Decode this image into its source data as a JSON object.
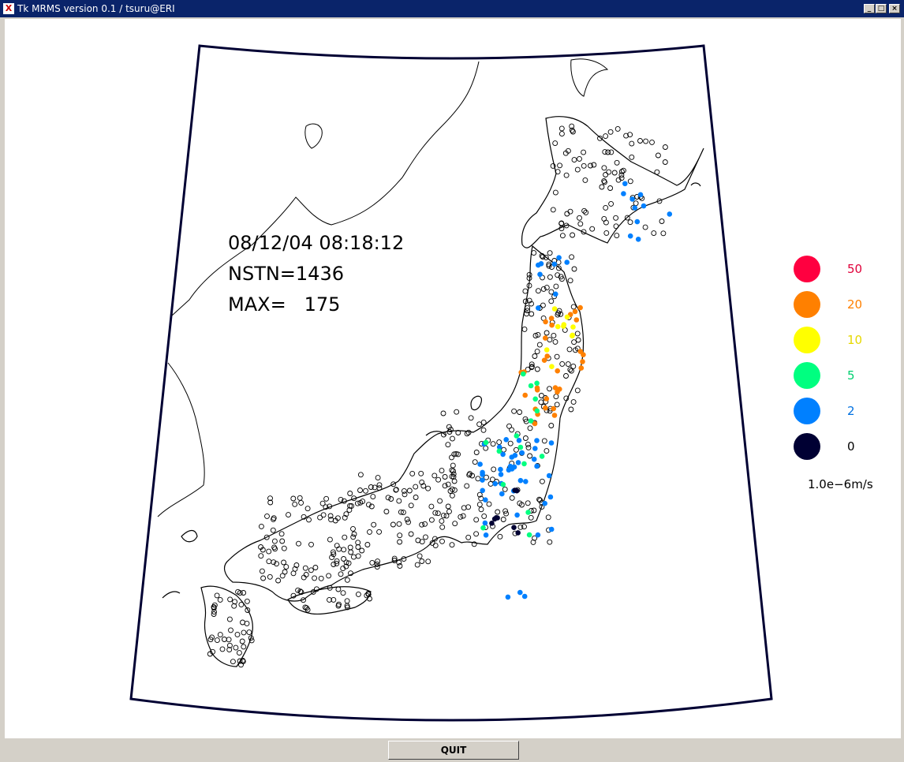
{
  "window": {
    "title": "Tk MRMS version 0.1 / tsuru@ERI",
    "app_icon": "x-icon",
    "controls": [
      "minimize-icon",
      "maximize-icon",
      "close-icon"
    ]
  },
  "map": {
    "datetime": "08/12/04 08:18:12",
    "nstn_label": "NSTN=1436",
    "max_label": "MAX=   175",
    "frame_color": "#000033"
  },
  "legend": {
    "items": [
      {
        "label": "50",
        "color": "#ff0040",
        "text_color": "#e0003a"
      },
      {
        "label": "20",
        "color": "#ff8000",
        "text_color": "#ff8000"
      },
      {
        "label": "10",
        "color": "#ffff00",
        "text_color": "#e6d800"
      },
      {
        "label": "5",
        "color": "#00ff80",
        "text_color": "#00d070"
      },
      {
        "label": "2",
        "color": "#0080ff",
        "text_color": "#0070e0"
      },
      {
        "label": "0",
        "color": "#000033",
        "text_color": "#000000"
      }
    ],
    "unit": "1.0e−6m/s"
  },
  "buttons": {
    "quit": "QUIT"
  }
}
